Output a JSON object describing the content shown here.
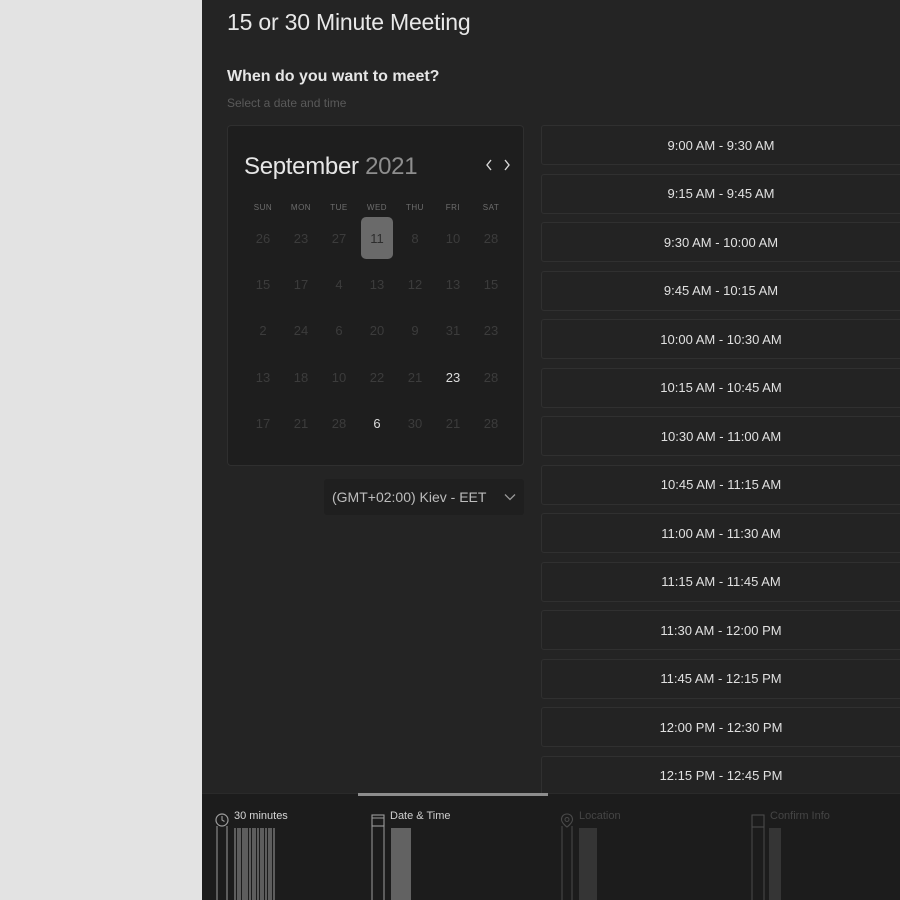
{
  "meeting": {
    "title": "15 or 30 Minute Meeting",
    "prompt": "When do you want to meet?",
    "subprompt": "Select a date and time"
  },
  "calendar": {
    "month": "September",
    "year": "2021",
    "prev_icon": "chevron-left-icon",
    "next_icon": "chevron-right-icon",
    "weekdays": [
      "SUN",
      "MON",
      "TUE",
      "WED",
      "THU",
      "FRI",
      "SAT"
    ],
    "weeks": [
      [
        {
          "d": "26",
          "s": "disabled"
        },
        {
          "d": "23",
          "s": "disabled"
        },
        {
          "d": "27",
          "s": "disabled"
        },
        {
          "d": "11",
          "s": "selected"
        },
        {
          "d": "8",
          "s": "disabled"
        },
        {
          "d": "10",
          "s": "disabled"
        },
        {
          "d": "28",
          "s": "disabled"
        }
      ],
      [
        {
          "d": "15",
          "s": "disabled"
        },
        {
          "d": "17",
          "s": "disabled"
        },
        {
          "d": "4",
          "s": "disabled"
        },
        {
          "d": "13",
          "s": "disabled"
        },
        {
          "d": "12",
          "s": "disabled"
        },
        {
          "d": "13",
          "s": "disabled"
        },
        {
          "d": "15",
          "s": "disabled"
        }
      ],
      [
        {
          "d": "2",
          "s": "disabled"
        },
        {
          "d": "24",
          "s": "disabled"
        },
        {
          "d": "6",
          "s": "disabled"
        },
        {
          "d": "20",
          "s": "disabled"
        },
        {
          "d": "9",
          "s": "disabled"
        },
        {
          "d": "31",
          "s": "disabled"
        },
        {
          "d": "23",
          "s": "disabled"
        }
      ],
      [
        {
          "d": "13",
          "s": "disabled"
        },
        {
          "d": "18",
          "s": "disabled"
        },
        {
          "d": "10",
          "s": "disabled"
        },
        {
          "d": "22",
          "s": "disabled"
        },
        {
          "d": "21",
          "s": "disabled"
        },
        {
          "d": "23",
          "s": "available"
        },
        {
          "d": "28",
          "s": "disabled"
        }
      ],
      [
        {
          "d": "17",
          "s": "disabled"
        },
        {
          "d": "21",
          "s": "disabled"
        },
        {
          "d": "28",
          "s": "disabled"
        },
        {
          "d": "6",
          "s": "available"
        },
        {
          "d": "30",
          "s": "disabled"
        },
        {
          "d": "21",
          "s": "disabled"
        },
        {
          "d": "28",
          "s": "disabled"
        }
      ]
    ]
  },
  "timezone": {
    "label": "(GMT+02:00) Kiev - EET",
    "icon": "chevron-down-icon"
  },
  "time_slots": [
    "9:00 AM - 9:30 AM",
    "9:15 AM - 9:45 AM",
    "9:30 AM - 10:00 AM",
    "9:45 AM - 10:15 AM",
    "10:00 AM - 10:30 AM",
    "10:15 AM - 10:45 AM",
    "10:30 AM - 11:00 AM",
    "10:45 AM - 11:15 AM",
    "11:00 AM - 11:30 AM",
    "11:15 AM - 11:45 AM",
    "11:30 AM - 12:00 PM",
    "11:45 AM - 12:15 PM",
    "12:00 PM - 12:30 PM",
    "12:15 PM - 12:45 PM"
  ],
  "steps": [
    {
      "label": "30 minutes",
      "icon": "clock-icon",
      "state": "done"
    },
    {
      "label": "Date & Time",
      "icon": "calendar-icon",
      "state": "active"
    },
    {
      "label": "Location",
      "icon": "location-pin-icon",
      "state": "upcoming"
    },
    {
      "label": "Confirm Info",
      "icon": "document-icon",
      "state": "upcoming"
    }
  ],
  "colors": {
    "panel_bg": "#242424",
    "page_bg": "#e3e3e3",
    "selected_day_bg": "#6a6a6a",
    "text_primary": "#e6e6e6",
    "text_muted": "#5a5a5a"
  }
}
